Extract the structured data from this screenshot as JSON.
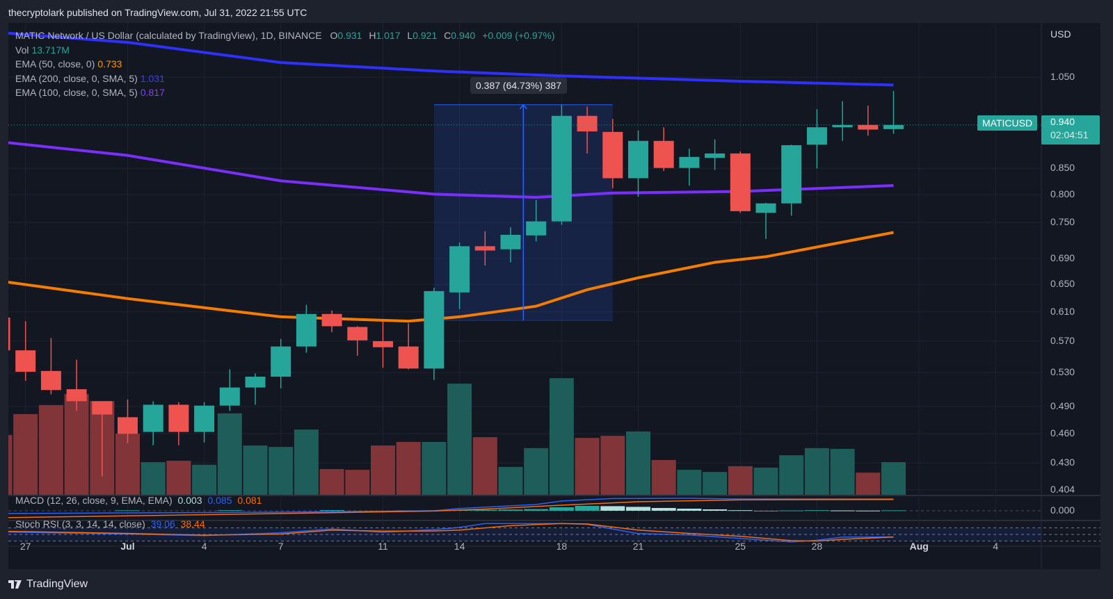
{
  "publisher": "thecryptolark published on TradingView.com, Jul 31, 2022 21:55 UTC",
  "legend": {
    "symbol": "MATIC Network / US Dollar (calculated by TradingView), 1D, BINANCE",
    "o_label": "O",
    "o": "0.931",
    "h_label": "H",
    "h": "1.017",
    "l_label": "L",
    "l": "0.921",
    "c_label": "C",
    "c": "0.940",
    "change": "+0.009 (+0.97%)",
    "vol_label": "Vol",
    "vol": "13.717M",
    "ema50_label": "EMA (50, close, 0)",
    "ema50": "0.733",
    "ema200_label": "EMA (200, close, 0, SMA, 5)",
    "ema200": "1.031",
    "ema100_label": "EMA (100, close, 0, SMA, 5)",
    "ema100": "0.817"
  },
  "macd": {
    "label": "MACD (12, 26, close, 9, EMA, EMA)",
    "hist": "0.003",
    "macd": "0.085",
    "signal": "0.081"
  },
  "stoch": {
    "label": "Stoch RSI (3, 3, 14, 14, close)",
    "k": "39.06",
    "d": "38.44"
  },
  "price_axis": {
    "currency": "USD",
    "zero": "0.000"
  },
  "last_price": {
    "symbol": "MATICUSD",
    "price": "0.940",
    "countdown": "02:04:51"
  },
  "footer": {
    "brand": "TradingView"
  },
  "colors": {
    "up": "#26a69a",
    "down": "#ef5350",
    "vol_up": "#1d5e5a",
    "vol_down": "#823538",
    "ema50": "#f57c00",
    "ema100": "#7b2fff",
    "ema200": "#2f2fff",
    "macd": "#2962ff",
    "signal": "#ff6d00",
    "measure": "#2962ff"
  },
  "chart_data": {
    "type": "candlestick",
    "scale": "log",
    "interval": "1D",
    "ylim": [
      0.404,
      1.17
    ],
    "grid": true,
    "y_ticks": [
      "1.050",
      "0.850",
      "0.800",
      "0.750",
      "0.690",
      "0.650",
      "0.610",
      "0.570",
      "0.530",
      "0.490",
      "0.460",
      "0.430",
      "0.404"
    ],
    "x_ticks": [
      {
        "date": "2022-06-27",
        "label": "27"
      },
      {
        "date": "2022-07-01",
        "label": "Jul",
        "major": true
      },
      {
        "date": "2022-07-04",
        "label": "4"
      },
      {
        "date": "2022-07-07",
        "label": "7"
      },
      {
        "date": "2022-07-11",
        "label": "11"
      },
      {
        "date": "2022-07-14",
        "label": "14"
      },
      {
        "date": "2022-07-18",
        "label": "18"
      },
      {
        "date": "2022-07-21",
        "label": "21"
      },
      {
        "date": "2022-07-25",
        "label": "25"
      },
      {
        "date": "2022-07-28",
        "label": "28"
      },
      {
        "date": "2022-08-01",
        "label": "Aug",
        "major": true
      },
      {
        "date": "2022-08-04",
        "label": "4"
      }
    ],
    "dates": [
      "2022-06-26",
      "2022-06-27",
      "2022-06-28",
      "2022-06-29",
      "2022-06-30",
      "2022-07-01",
      "2022-07-02",
      "2022-07-03",
      "2022-07-04",
      "2022-07-05",
      "2022-07-06",
      "2022-07-07",
      "2022-07-08",
      "2022-07-09",
      "2022-07-10",
      "2022-07-11",
      "2022-07-12",
      "2022-07-13",
      "2022-07-14",
      "2022-07-15",
      "2022-07-16",
      "2022-07-17",
      "2022-07-18",
      "2022-07-19",
      "2022-07-20",
      "2022-07-21",
      "2022-07-22",
      "2022-07-23",
      "2022-07-24",
      "2022-07-25",
      "2022-07-26",
      "2022-07-27",
      "2022-07-28",
      "2022-07-29",
      "2022-07-30",
      "2022-07-31"
    ],
    "ohlc": [
      [
        0.602,
        0.605,
        0.555,
        0.558
      ],
      [
        0.558,
        0.597,
        0.52,
        0.531
      ],
      [
        0.532,
        0.574,
        0.504,
        0.509
      ],
      [
        0.51,
        0.546,
        0.485,
        0.496
      ],
      [
        0.496,
        0.496,
        0.417,
        0.481
      ],
      [
        0.478,
        0.498,
        0.45,
        0.46
      ],
      [
        0.462,
        0.496,
        0.448,
        0.492
      ],
      [
        0.492,
        0.495,
        0.448,
        0.462
      ],
      [
        0.462,
        0.495,
        0.451,
        0.491
      ],
      [
        0.491,
        0.534,
        0.485,
        0.512
      ],
      [
        0.512,
        0.529,
        0.492,
        0.525
      ],
      [
        0.525,
        0.573,
        0.511,
        0.563
      ],
      [
        0.563,
        0.62,
        0.555,
        0.607
      ],
      [
        0.607,
        0.612,
        0.582,
        0.59
      ],
      [
        0.589,
        0.59,
        0.551,
        0.571
      ],
      [
        0.57,
        0.597,
        0.536,
        0.562
      ],
      [
        0.563,
        0.594,
        0.534,
        0.535
      ],
      [
        0.535,
        0.645,
        0.521,
        0.64
      ],
      [
        0.638,
        0.716,
        0.614,
        0.71
      ],
      [
        0.71,
        0.735,
        0.679,
        0.703
      ],
      [
        0.705,
        0.742,
        0.684,
        0.729
      ],
      [
        0.728,
        0.79,
        0.718,
        0.752
      ],
      [
        0.752,
        0.985,
        0.746,
        0.96
      ],
      [
        0.96,
        0.981,
        0.88,
        0.926
      ],
      [
        0.925,
        0.953,
        0.812,
        0.831
      ],
      [
        0.831,
        0.928,
        0.796,
        0.906
      ],
      [
        0.906,
        0.935,
        0.845,
        0.851
      ],
      [
        0.851,
        0.89,
        0.817,
        0.873
      ],
      [
        0.871,
        0.909,
        0.847,
        0.88
      ],
      [
        0.88,
        0.884,
        0.767,
        0.77
      ],
      [
        0.767,
        0.785,
        0.722,
        0.784
      ],
      [
        0.784,
        0.898,
        0.762,
        0.897
      ],
      [
        0.898,
        0.975,
        0.85,
        0.935
      ],
      [
        0.935,
        0.993,
        0.906,
        0.94
      ],
      [
        0.94,
        0.983,
        0.917,
        0.93
      ],
      [
        0.931,
        1.017,
        0.921,
        0.94
      ]
    ],
    "volume_millions": [
      25.1,
      33.9,
      37.7,
      42.3,
      39.4,
      25.7,
      13.7,
      14.3,
      12.6,
      34.2,
      20.7,
      20.1,
      27.4,
      10.8,
      10.5,
      20.7,
      22.2,
      22.2,
      46.7,
      24.2,
      11.7,
      19.6,
      49.0,
      23.9,
      24.8,
      26.6,
      14.6,
      10.5,
      9.6,
      12.0,
      11.4,
      16.6,
      19.6,
      19.3,
      9.3,
      13.717
    ],
    "ema200": [
      [
        "2022-06-26",
        1.164
      ],
      [
        "2022-07-01",
        1.138
      ],
      [
        "2022-07-07",
        1.086
      ],
      [
        "2022-07-13",
        1.065
      ],
      [
        "2022-07-18",
        1.053
      ],
      [
        "2022-07-25",
        1.04
      ],
      [
        "2022-07-31",
        1.031
      ]
    ],
    "ema100": [
      [
        "2022-06-26",
        0.904
      ],
      [
        "2022-07-01",
        0.876
      ],
      [
        "2022-07-07",
        0.826
      ],
      [
        "2022-07-13",
        0.801
      ],
      [
        "2022-07-17",
        0.795
      ],
      [
        "2022-07-20",
        0.803
      ],
      [
        "2022-07-25",
        0.806
      ],
      [
        "2022-07-31",
        0.817
      ]
    ],
    "ema50": [
      [
        "2022-06-26",
        0.655
      ],
      [
        "2022-07-01",
        0.629
      ],
      [
        "2022-07-07",
        0.603
      ],
      [
        "2022-07-12",
        0.597
      ],
      [
        "2022-07-14",
        0.603
      ],
      [
        "2022-07-17",
        0.618
      ],
      [
        "2022-07-19",
        0.642
      ],
      [
        "2022-07-21",
        0.66
      ],
      [
        "2022-07-24",
        0.684
      ],
      [
        "2022-07-26",
        0.693
      ],
      [
        "2022-07-31",
        0.733
      ]
    ],
    "macd_line": [
      [
        "2022-06-26",
        -0.02
      ],
      [
        "2022-07-07",
        -0.01
      ],
      [
        "2022-07-13",
        0.0
      ],
      [
        "2022-07-14",
        0.016
      ],
      [
        "2022-07-17",
        0.045
      ],
      [
        "2022-07-18",
        0.07
      ],
      [
        "2022-07-20",
        0.088
      ],
      [
        "2022-07-23",
        0.09
      ],
      [
        "2022-07-25",
        0.085
      ],
      [
        "2022-07-31",
        0.085
      ]
    ],
    "signal_line": [
      [
        "2022-06-26",
        -0.05
      ],
      [
        "2022-07-07",
        -0.02
      ],
      [
        "2022-07-13",
        -0.002
      ],
      [
        "2022-07-15",
        0.012
      ],
      [
        "2022-07-18",
        0.04
      ],
      [
        "2022-07-21",
        0.065
      ],
      [
        "2022-07-25",
        0.078
      ],
      [
        "2022-07-31",
        0.081
      ]
    ],
    "macd_hist": [
      [
        "2022-07-01",
        0.003
      ],
      [
        "2022-07-05",
        0.004
      ],
      [
        "2022-07-09",
        0.005
      ],
      [
        "2022-07-12",
        0.002
      ],
      [
        "2022-07-13",
        0.003
      ],
      [
        "2022-07-14",
        0.005
      ],
      [
        "2022-07-15",
        0.007
      ],
      [
        "2022-07-16",
        0.009
      ],
      [
        "2022-07-17",
        0.012
      ],
      [
        "2022-07-18",
        0.025
      ],
      [
        "2022-07-19",
        0.035
      ],
      [
        "2022-07-20",
        0.033
      ],
      [
        "2022-07-21",
        0.028
      ],
      [
        "2022-07-22",
        0.02
      ],
      [
        "2022-07-23",
        0.015
      ],
      [
        "2022-07-24",
        0.01
      ],
      [
        "2022-07-25",
        0.004
      ],
      [
        "2022-07-26",
        -0.002
      ],
      [
        "2022-07-27",
        0.002
      ],
      [
        "2022-07-28",
        0.004
      ],
      [
        "2022-07-29",
        0.002
      ],
      [
        "2022-07-30",
        0.001
      ],
      [
        "2022-07-31",
        0.003
      ]
    ],
    "stoch_k": [
      [
        "2022-06-26",
        62
      ],
      [
        "2022-07-01",
        52
      ],
      [
        "2022-07-04",
        45
      ],
      [
        "2022-07-07",
        58
      ],
      [
        "2022-07-09",
        75
      ],
      [
        "2022-07-11",
        60
      ],
      [
        "2022-07-13",
        72
      ],
      [
        "2022-07-14",
        82
      ],
      [
        "2022-07-15",
        100
      ],
      [
        "2022-07-18",
        100
      ],
      [
        "2022-07-19",
        96
      ],
      [
        "2022-07-21",
        54
      ],
      [
        "2022-07-23",
        48
      ],
      [
        "2022-07-25",
        32
      ],
      [
        "2022-07-27",
        16
      ],
      [
        "2022-07-28",
        24
      ],
      [
        "2022-07-29",
        38
      ],
      [
        "2022-07-31",
        39.06
      ]
    ],
    "stoch_d": [
      [
        "2022-06-26",
        65
      ],
      [
        "2022-07-01",
        55
      ],
      [
        "2022-07-04",
        47
      ],
      [
        "2022-07-07",
        52
      ],
      [
        "2022-07-09",
        70
      ],
      [
        "2022-07-11",
        65
      ],
      [
        "2022-07-13",
        66
      ],
      [
        "2022-07-14",
        70
      ],
      [
        "2022-07-16",
        90
      ],
      [
        "2022-07-18",
        100
      ],
      [
        "2022-07-19",
        98
      ],
      [
        "2022-07-21",
        70
      ],
      [
        "2022-07-23",
        55
      ],
      [
        "2022-07-25",
        42
      ],
      [
        "2022-07-27",
        22
      ],
      [
        "2022-07-28",
        20
      ],
      [
        "2022-07-29",
        28
      ],
      [
        "2022-07-31",
        38.44
      ]
    ],
    "measure": {
      "from": "2022-07-13",
      "to": "2022-07-20",
      "low": 0.598,
      "high": 0.985,
      "label": "0.387 (64.73%) 387"
    }
  }
}
